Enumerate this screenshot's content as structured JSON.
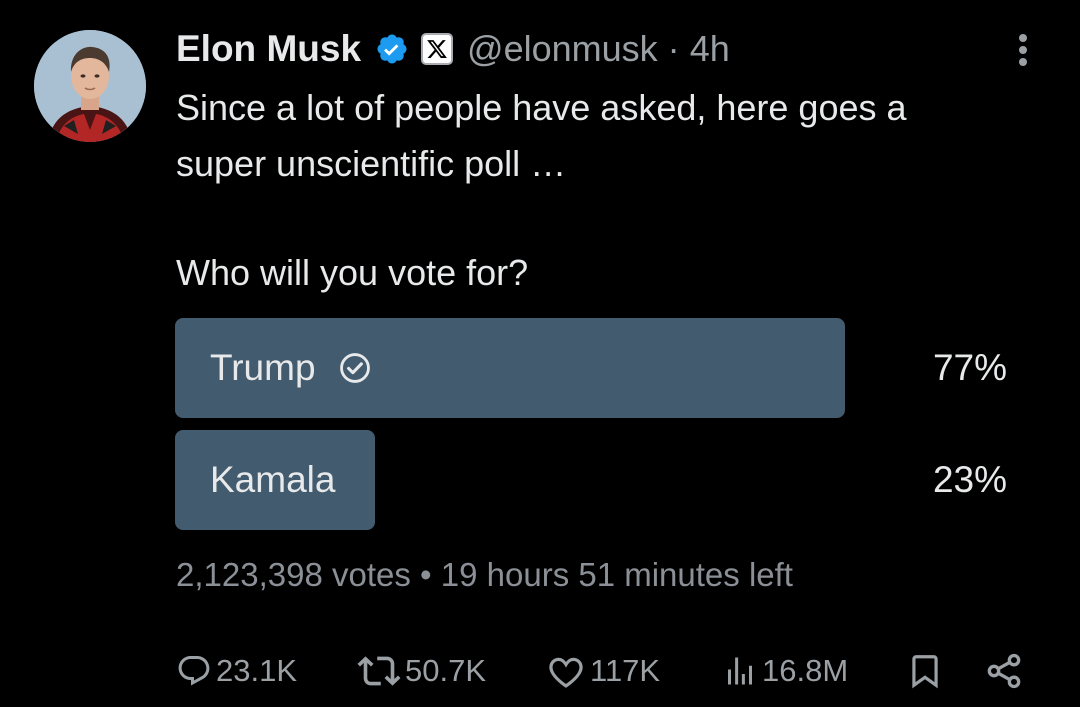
{
  "author": {
    "display_name": "Elon Musk",
    "handle": "@elonmusk",
    "separator": "·",
    "time": "4h",
    "verified_color": "#1d9bf0"
  },
  "tweet": {
    "text_line1": "Since a lot of people have asked, here goes a",
    "text_line2": "super unscientific poll …",
    "poll_question": "Who will you vote for?"
  },
  "poll": {
    "bar_color": "#435b6e",
    "options": [
      {
        "label": "Trump",
        "percent_text": "77%",
        "percent": 77,
        "winner": true
      },
      {
        "label": "Kamala",
        "percent_text": "23%",
        "percent": 23,
        "winner": false
      }
    ],
    "votes": "2,123,398 votes",
    "meta_separator": "•",
    "time_left": "19 hours 51 minutes left"
  },
  "actions": {
    "replies": "23.1K",
    "reposts": "50.7K",
    "likes": "117K",
    "views": "16.8M"
  },
  "icons": {
    "verified": "verified-badge-icon",
    "org": "x-logo-icon",
    "more": "more-icon",
    "reply": "reply-icon",
    "repost": "repost-icon",
    "like": "heart-icon",
    "views": "views-icon",
    "bookmark": "bookmark-icon",
    "share": "share-icon"
  }
}
